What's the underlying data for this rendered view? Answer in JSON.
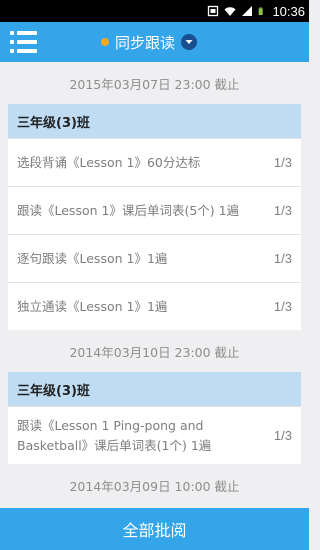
{
  "status_bar": {
    "time": "10:36"
  },
  "top_bar": {
    "title": "同步跟读"
  },
  "groups": [
    {
      "date": "2015年03月07日  23:00 截止",
      "class_name": "三年级(3)班",
      "items": [
        {
          "text": "选段背诵《Lesson 1》60分达标",
          "count": "1/3"
        },
        {
          "text": "跟读《Lesson 1》课后单词表(5个) 1遍",
          "count": "1/3"
        },
        {
          "text": "逐句跟读《Lesson 1》1遍",
          "count": "1/3"
        },
        {
          "text": "独立通读《Lesson 1》1遍",
          "count": "1/3"
        }
      ]
    },
    {
      "date": "2014年03月10日  23:00 截止",
      "class_name": "三年级(3)班",
      "items": [
        {
          "text": "跟读《Lesson 1 Ping-pong and Basketball》课后单词表(1个) 1遍",
          "count": "1/3"
        }
      ]
    },
    {
      "date": "2014年03月09日  10:00 截止"
    }
  ],
  "bottom_button": {
    "label": "全部批阅"
  },
  "icons": {
    "menu": "menu-icon",
    "dropdown": "chevron-down-icon",
    "status": [
      "photo-icon",
      "wifi-icon",
      "signal-icon",
      "battery-icon"
    ]
  },
  "colors": {
    "primary": "#34a5e8",
    "card_header": "#bfdcf3",
    "title_dot": "#f5a623"
  }
}
